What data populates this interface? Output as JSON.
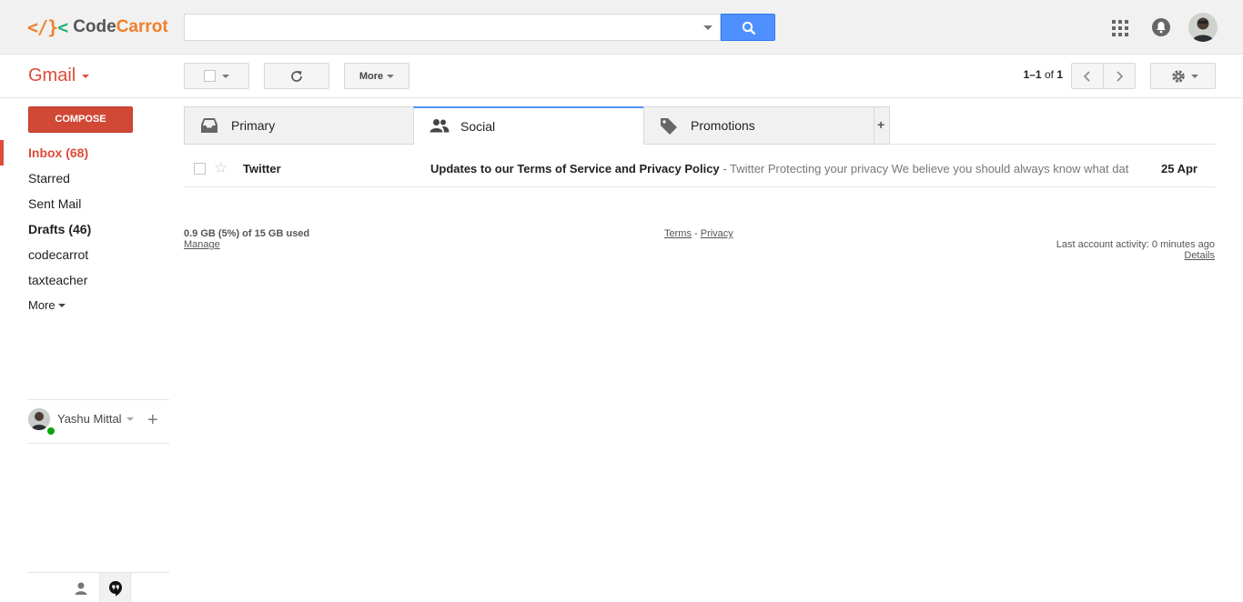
{
  "brand": {
    "logo_prefix": "<",
    "logo_slash": "/}",
    "logo_suffix": "<",
    "name_first": "Code",
    "name_second": "Carrot"
  },
  "search": {
    "value": "",
    "placeholder": ""
  },
  "header": {
    "app_switcher": "Gmail"
  },
  "toolbar": {
    "more_label": "More",
    "pager_range": "1–1",
    "pager_of": "of",
    "pager_total": "1"
  },
  "compose_label": "COMPOSE",
  "sidebar": {
    "items": [
      {
        "label": "Inbox (68)"
      },
      {
        "label": "Starred"
      },
      {
        "label": "Sent Mail"
      },
      {
        "label": "Drafts (46)"
      },
      {
        "label": "codecarrot"
      },
      {
        "label": "taxteacher"
      },
      {
        "label": "More"
      }
    ]
  },
  "hangouts": {
    "user_name": "Yashu Mittal",
    "add": "+"
  },
  "tabs": [
    {
      "label": "Primary"
    },
    {
      "label": "Social"
    },
    {
      "label": "Promotions"
    }
  ],
  "tab_add": "+",
  "messages": [
    {
      "sender": "Twitter",
      "subject": "Updates to our Terms of Service and Privacy Policy",
      "snippet": " - Twitter Protecting your privacy We believe you should always know what dat",
      "date": "25 Apr"
    }
  ],
  "footer": {
    "storage": "0.9 GB (5%) of 15 GB used",
    "manage": "Manage",
    "terms": "Terms",
    "separator": " - ",
    "privacy": "Privacy",
    "activity": "Last account activity: 0 minutes ago",
    "details": "Details"
  },
  "colors": {
    "brand_red": "#dd4b39",
    "compose_red": "#d14836",
    "search_blue": "#4d90fe",
    "online_green": "#0ca40c"
  }
}
